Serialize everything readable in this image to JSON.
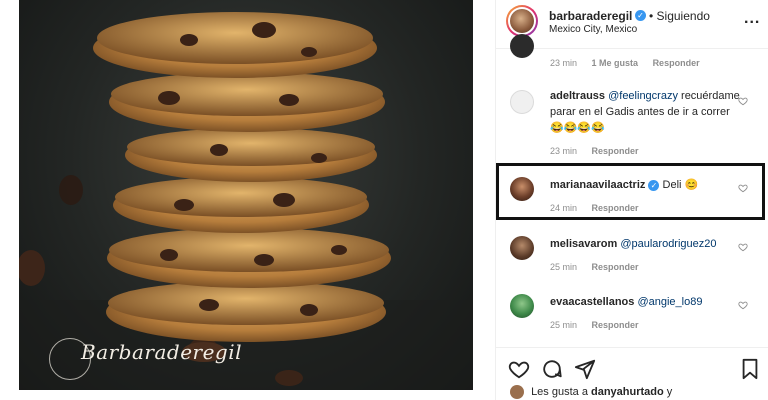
{
  "post": {
    "watermark": "Barbaraderegil"
  },
  "header": {
    "username": "barbaraderegil",
    "follow_status": "• Siguiendo",
    "location": "Mexico City, Mexico",
    "more_label": "..."
  },
  "comments": [
    {
      "meta": {
        "time": "23 min",
        "likes": "1 Me gusta",
        "reply": "Responder"
      }
    },
    {
      "username": "adeltrauss",
      "mention": "@feelingcrazy",
      "text": "recuérdame parar en el Gadis antes de ir a correr 😂😂😂😂",
      "meta": {
        "time": "23 min",
        "reply": "Responder"
      }
    },
    {
      "username": "marianaavilaactriz",
      "text": "Deli 😊",
      "meta": {
        "time": "24 min",
        "reply": "Responder"
      }
    },
    {
      "username": "melisavarom",
      "mention": "@paularodriguez20",
      "meta": {
        "time": "25 min",
        "reply": "Responder"
      }
    },
    {
      "username": "evaacastellanos",
      "mention": "@angie_lo89",
      "meta": {
        "time": "25 min",
        "reply": "Responder"
      }
    }
  ],
  "likes": {
    "prefix": "Les gusta a",
    "user": "danyahurtado",
    "suffix": "y"
  },
  "colors": {
    "verified": "#3897f0",
    "mention": "#00376b",
    "meta": "#8e8e8e",
    "highlight_border": "#111111"
  },
  "icons": [
    "heart-icon",
    "comment-icon",
    "share-icon",
    "bookmark-icon",
    "verified-icon",
    "more-icon"
  ]
}
